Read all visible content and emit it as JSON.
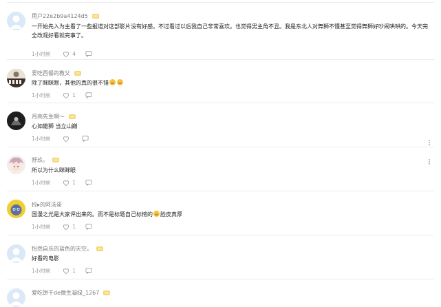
{
  "top_stub": {
    "like_count": "6"
  },
  "comments": [
    {
      "username": "用户22e2b9a4124d5",
      "text": "一开始先入为主看了一些报道对这部影片没有好感。不过看过以后我自己非常喜欢。也觉得男主角不丑。我是东北人对舞狮不懂甚至觉得舞狮好吵闹哄哄的。今天完全改观好看就完事了。",
      "time": "1小时前",
      "likes": "4",
      "avatar": "default-avatar"
    },
    {
      "username": "爱吃西餐的教父",
      "text": "除了眯眯眼，其他的真的很不错",
      "time": "1小时前",
      "likes": "1",
      "avatar": "film-poster-avatar"
    },
    {
      "username": "月亮先生啊～",
      "text": "心如雄狮 当立山巅",
      "time": "1小时前",
      "likes": "",
      "avatar": "dark-figure-avatar"
    },
    {
      "username": "舒玖。",
      "text": "所以为什么眯眯眼",
      "time": "1小时前",
      "likes": "1",
      "avatar": "anime-avatar"
    },
    {
      "username": "捡▸的阿汤哥",
      "text_before": "国漫之光是大家评出来的。而不是标题自己标榜的",
      "text_after": "脸皮真厚",
      "time": "1小时前",
      "likes": "1",
      "avatar": "yellow-cartoon-avatar"
    },
    {
      "username": "怡然自乐的蓝色的天空。",
      "text": "好看的电影",
      "time": "1小时前",
      "likes": "1",
      "avatar": "default-avatar"
    },
    {
      "username": "爱吃饼干de微生凝绿_1267",
      "avatar": "default-avatar"
    }
  ],
  "colors": {
    "username": "#7b7b7b",
    "text": "#222222",
    "meta": "#9a9a9a",
    "divider": "#ececec",
    "badge": "#f6d77a"
  }
}
